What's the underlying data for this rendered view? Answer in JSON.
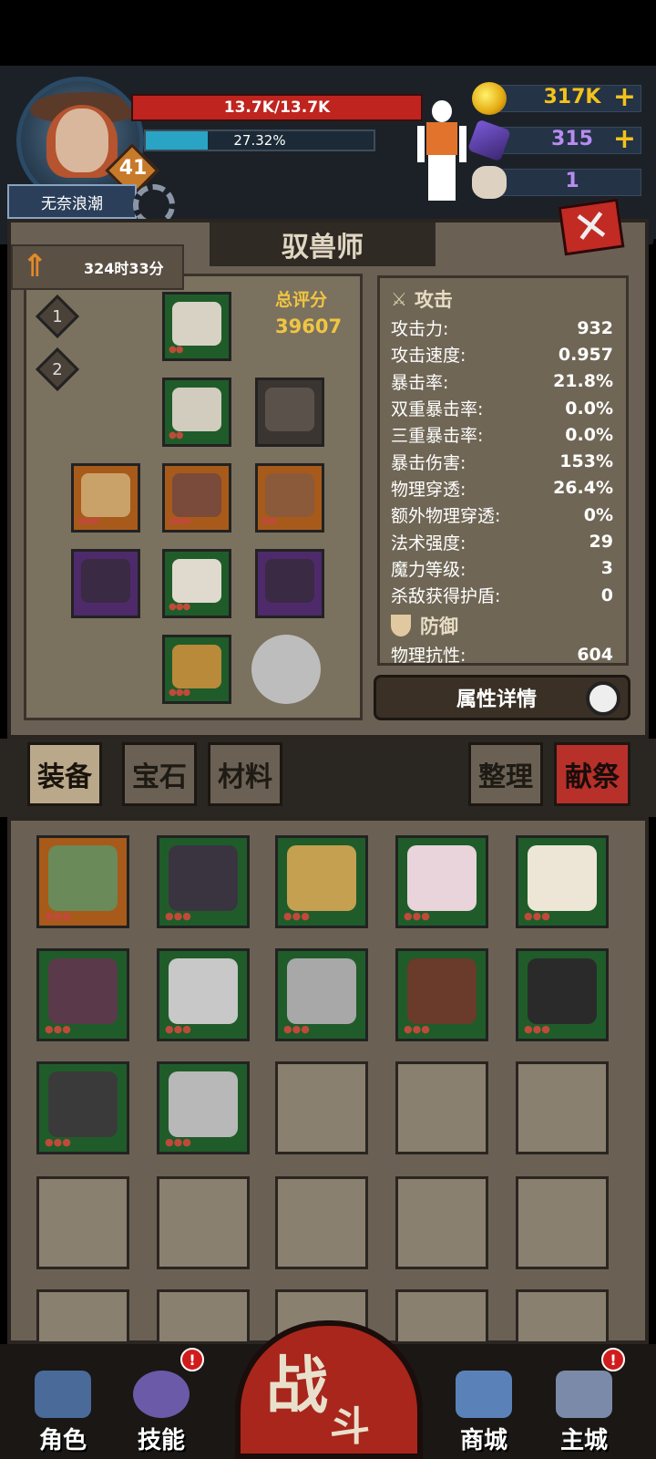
{
  "header": {
    "player_name": "无奈浪潮",
    "level": "41",
    "hp_text": "13.7K/13.7K",
    "xp_text": "27.32%",
    "xp_percent": 27.32
  },
  "currencies": {
    "gold": "317K",
    "gems": "315",
    "skull": "1",
    "plus": "+"
  },
  "panel": {
    "title": "驭兽师",
    "timer": "324时33分",
    "slot_1": "1",
    "slot_2": "2",
    "score_label": "总评分",
    "score_value": "39607",
    "close_label": "✕"
  },
  "stats": {
    "attack_header": "攻击",
    "defense_header": "防御",
    "rows": [
      {
        "label": "攻击力:",
        "value": "932"
      },
      {
        "label": "攻击速度:",
        "value": "0.957"
      },
      {
        "label": "暴击率:",
        "value": "21.8%"
      },
      {
        "label": "双重暴击率:",
        "value": "0.0%"
      },
      {
        "label": "三重暴击率:",
        "value": "0.0%"
      },
      {
        "label": "暴击伤害:",
        "value": "153%"
      },
      {
        "label": "物理穿透:",
        "value": "26.4%"
      },
      {
        "label": "额外物理穿透:",
        "value": "0%"
      },
      {
        "label": "法术强度:",
        "value": "29"
      },
      {
        "label": "魔力等级:",
        "value": "3"
      },
      {
        "label": "杀敌获得护盾:",
        "value": "0"
      }
    ],
    "partial_row": {
      "label": "物理抗性:",
      "value": "604"
    },
    "detail_button": "属性详情"
  },
  "tabs": {
    "equip": "装备",
    "gem": "宝石",
    "material": "材料",
    "sort": "整理",
    "sacrifice": "献祭"
  },
  "nav": {
    "role": "角色",
    "skill": "技能",
    "battle_1": "战",
    "battle_2": "斗",
    "shop": "商城",
    "city": "主城",
    "badge": "!"
  }
}
